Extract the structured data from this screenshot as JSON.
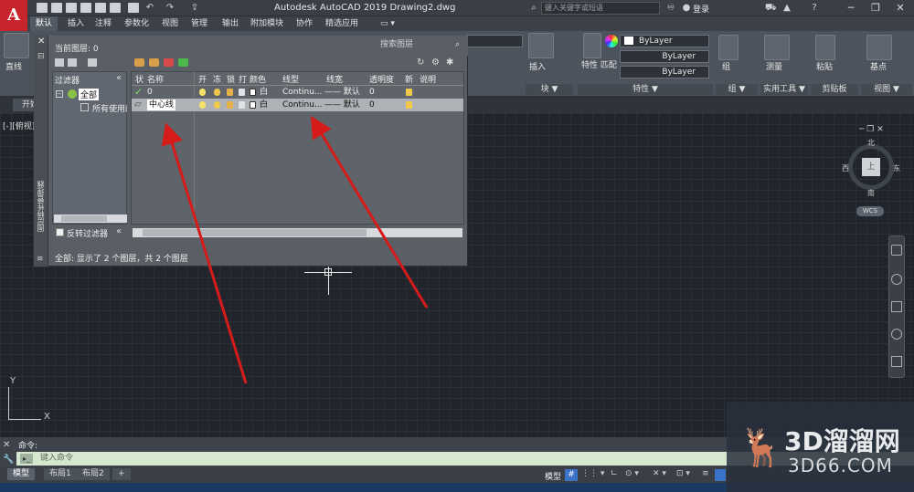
{
  "app": {
    "title": "Autodesk AutoCAD 2019    Drawing2.dwg",
    "search_placeholder": "键入关键字或短语",
    "login": "登录"
  },
  "ribbon_tabs": [
    "默认",
    "插入",
    "注释",
    "参数化",
    "视图",
    "管理",
    "输出",
    "附加模块",
    "协作",
    "精选应用"
  ],
  "ribbon": {
    "insert": "插入",
    "properties_match": "特性\n匹配",
    "bylayer1": "ByLayer",
    "bylayer2": "ByLayer",
    "bylayer3": "ByLayer",
    "group": "组",
    "measure": "测量",
    "paste": "粘贴",
    "base": "基点",
    "panel_block": "块 ▼",
    "panel_props": "特性 ▼",
    "panel_group": "组 ▼",
    "panel_util": "实用工具 ▼",
    "panel_clip": "剪贴板",
    "panel_view": "视图 ▼",
    "line": "直线"
  },
  "filetab": {
    "start": "开始"
  },
  "viewport": {
    "label": "[-][俯视]",
    "compass": {
      "n": "北",
      "s": "南",
      "e": "东",
      "w": "西",
      "center": "上"
    },
    "wcs": "WCS",
    "axis_y": "Y",
    "axis_x": "X"
  },
  "layer_palette": {
    "current_layer": "当前图层: 0",
    "search_placeholder": "搜索图层",
    "filters_title": "过滤器",
    "tree": {
      "all": "全部",
      "used": "所有使用的图层"
    },
    "invert_filter": "反转过滤器",
    "columns": [
      "状",
      "名称",
      "开",
      "冻",
      "锁",
      "打",
      "颜色",
      "线型",
      "线宽",
      "透明度",
      "新",
      "说明"
    ],
    "rows": [
      {
        "name": "0",
        "color": "白",
        "linetype": "Continu...",
        "lineweight": "—— 默认",
        "transparency": "0"
      },
      {
        "name": "中心线",
        "color": "白",
        "linetype": "Continu...",
        "lineweight": "—— 默认",
        "transparency": "0"
      }
    ],
    "status": "全部: 显示了 2 个图层，共 2 个图层",
    "side_title": "图层特性管理器"
  },
  "command": {
    "label": "命令:",
    "placeholder": "键入命令"
  },
  "status_tabs": [
    "模型",
    "布局1",
    "布局2",
    "+"
  ],
  "status_model": "模型",
  "watermark": {
    "line1": "3D溜溜网",
    "line2": "3D66.COM"
  },
  "colors": {
    "arrow": "#d61b1b",
    "accent": "#c8242b"
  }
}
